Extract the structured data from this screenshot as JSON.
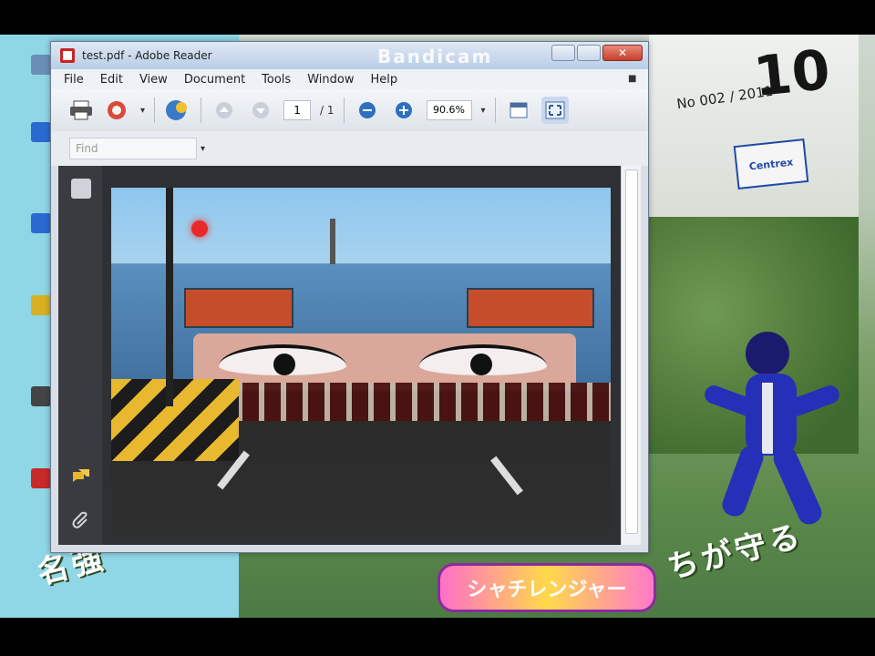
{
  "window": {
    "title": "test.pdf - Adobe Reader",
    "watermark": "Bandicam"
  },
  "menu": [
    "File",
    "Edit",
    "View",
    "Document",
    "Tools",
    "Window",
    "Help"
  ],
  "toolbar": {
    "page_current": "1",
    "page_total": "/ 1",
    "zoom": "90.6%"
  },
  "find": {
    "placeholder": "Find"
  },
  "magazine": {
    "issue": "No 002 / 2011",
    "number": "10",
    "badge": "Centrex"
  },
  "icons": {
    "print": "printer-icon",
    "share": "share-icon",
    "collab": "collaborate-icon",
    "prev": "prev-page-icon",
    "next": "next-page-icon",
    "zoom_out": "zoom-out-icon",
    "zoom_in": "zoom-in-icon",
    "fit_width": "fit-width-icon",
    "fullscreen": "fullscreen-icon"
  }
}
